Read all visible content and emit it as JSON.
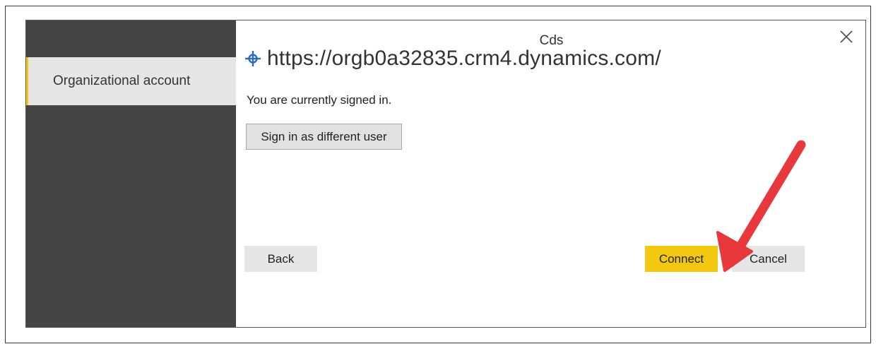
{
  "dialog": {
    "title": "Cds",
    "url": "https://orgb0a32835.crm4.dynamics.com/",
    "status": "You are currently signed in."
  },
  "sidebar": {
    "items": [
      {
        "label": "Organizational account",
        "selected": true
      }
    ]
  },
  "buttons": {
    "sign_in_different": "Sign in as different user",
    "back": "Back",
    "connect": "Connect",
    "cancel": "Cancel"
  },
  "icons": {
    "close": "close-icon",
    "url": "datasource-diamond-icon",
    "annotation": "red-arrow-annotation"
  },
  "colors": {
    "accent": "#f2c811",
    "sidebar_bg": "#444444",
    "url_icon": "#2a6ebb",
    "annotation": "#e8383d"
  }
}
